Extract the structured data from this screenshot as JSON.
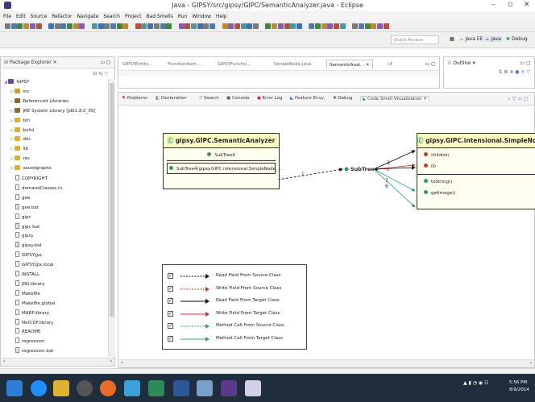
{
  "window": {
    "title": "Java - GIPSY/src/gipsy/GIPC/SemanticAnalyzer.java - Eclipse",
    "min": "–",
    "max": "▫",
    "close": "✕"
  },
  "menu": [
    "File",
    "Edit",
    "Source",
    "Refactor",
    "Navigate",
    "Search",
    "Project",
    "Bad Smells",
    "Run",
    "Window",
    "Help"
  ],
  "toolbar": {
    "quick_access_placeholder": "Quick Access",
    "perspectives": [
      "Java EE",
      "Java",
      "Debug"
    ]
  },
  "package_explorer": {
    "title": "Package Explorer ✕",
    "items": [
      {
        "label": "GIPSY",
        "indent": 0,
        "kind": "project"
      },
      {
        "label": "src",
        "indent": 1,
        "kind": "src"
      },
      {
        "label": "Referenced Libraries",
        "indent": 1,
        "kind": "lib"
      },
      {
        "label": "JRE System Library [jdk1.8.0_05]",
        "indent": 1,
        "kind": "lib"
      },
      {
        "label": "bin",
        "indent": 1,
        "kind": "folder"
      },
      {
        "label": "build",
        "indent": 1,
        "kind": "folder"
      },
      {
        "label": "doc",
        "indent": 1,
        "kind": "folder"
      },
      {
        "label": "lib",
        "indent": 1,
        "kind": "folder"
      },
      {
        "label": "res",
        "indent": 1,
        "kind": "folder"
      },
      {
        "label": "savedgraphs",
        "indent": 1,
        "kind": "folder"
      },
      {
        "label": "COPYRIGHT",
        "indent": 1,
        "kind": "file"
      },
      {
        "label": "demandClasses.in",
        "indent": 1,
        "kind": "file"
      },
      {
        "label": "gee",
        "indent": 1,
        "kind": "file"
      },
      {
        "label": "gee.bat",
        "indent": 1,
        "kind": "bat"
      },
      {
        "label": "gipc",
        "indent": 1,
        "kind": "file"
      },
      {
        "label": "gipc.bat",
        "indent": 1,
        "kind": "bat"
      },
      {
        "label": "gipsy",
        "indent": 1,
        "kind": "file"
      },
      {
        "label": "gipsy.bat",
        "indent": 1,
        "kind": "bat"
      },
      {
        "label": "GIPSY.jpx",
        "indent": 1,
        "kind": "file"
      },
      {
        "label": "GIPSY.jpx.local",
        "indent": 1,
        "kind": "file"
      },
      {
        "label": "INSTALL",
        "indent": 1,
        "kind": "file"
      },
      {
        "label": "JINI.library",
        "indent": 1,
        "kind": "file"
      },
      {
        "label": "Makefile",
        "indent": 1,
        "kind": "file"
      },
      {
        "label": "Makefile.global",
        "indent": 1,
        "kind": "file"
      },
      {
        "label": "MARF.library",
        "indent": 1,
        "kind": "file"
      },
      {
        "label": "NetCDF.library",
        "indent": 1,
        "kind": "file"
      },
      {
        "label": "README",
        "indent": 1,
        "kind": "file"
      },
      {
        "label": "regression",
        "indent": 1,
        "kind": "file"
      },
      {
        "label": "regression.bat",
        "indent": 1,
        "kind": "bat"
      }
    ]
  },
  "editor_tabs": [
    "GIPSYEntity...",
    "FunctionItem...",
    "GIPSYFunctio...",
    "SimpleNode.java",
    "SemanticAnal... ✕",
    "»3"
  ],
  "outline": {
    "title": "Outline ✕"
  },
  "views": [
    "Problems",
    "Declaration",
    "Search",
    "Console",
    "Error Log",
    "Feature Envy",
    "Debug",
    "Code Smell Visualization ✕"
  ],
  "diagram": {
    "source_class": {
      "name": "gipsy.GIPC.SemanticAnalyzer",
      "field": "SubTree4",
      "method": "SubTree4(gipsy.GIPC.intensional.SimpleNode_..."
    },
    "center_label": "SubTree4",
    "target_class": {
      "name": "gipsy.GIPC.intensional.SimpleNode",
      "fields": [
        "children",
        "ID"
      ],
      "methods": [
        "toString()",
        "getImage()"
      ]
    },
    "edge_numbers": [
      "1",
      "3",
      "2",
      "7",
      "6"
    ],
    "legend": [
      {
        "label": "Read Field From Source Class",
        "color": "#000000",
        "dashed": true
      },
      {
        "label": "Write Field From Source Class",
        "color": "#c0392b",
        "dashed": true
      },
      {
        "label": "Read Field From Target Class",
        "color": "#000000",
        "dashed": false
      },
      {
        "label": "Write Field From Target Class",
        "color": "#c0392b",
        "dashed": false
      },
      {
        "label": "Method Call From Source Class",
        "color": "#2aa08a",
        "dashed": true
      },
      {
        "label": "Method Call From Target Class",
        "color": "#2aa08a",
        "dashed": false
      }
    ]
  },
  "taskbar": {
    "time": "5:56 PM",
    "date": "8/9/2014"
  }
}
